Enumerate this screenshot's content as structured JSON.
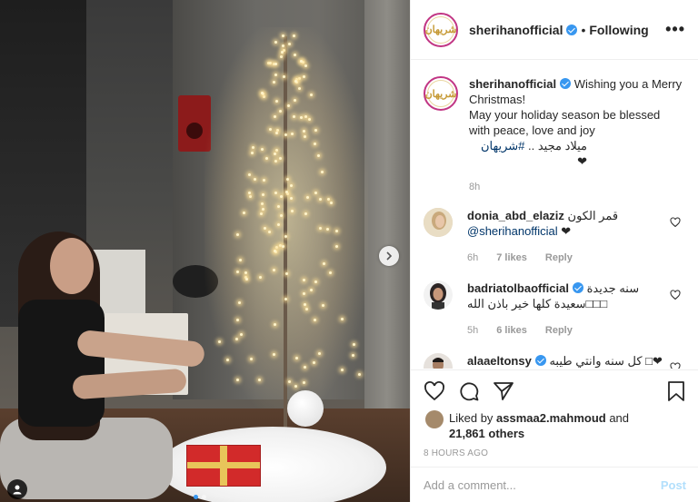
{
  "post": {
    "author": "sherihanofficial",
    "follow_state": "Following",
    "separator": "•",
    "more_label": "•••",
    "avatar_text": "شريهان"
  },
  "caption": {
    "username": "sherihanofficial",
    "line1": "Wishing you a Merry Christmas!",
    "line2": "May your holiday season be blessed with peace, love and joy",
    "line3_text": "ميلاد مجيد .. ",
    "hashtag": "#شريهان",
    "heart": "❤",
    "time": "8h"
  },
  "comments": [
    {
      "username": "donia_abd_elaziz",
      "text": "قمر الكون",
      "mention": "@sherihanofficial",
      "suffix": " ❤",
      "time": "6h",
      "likes": "7 likes",
      "reply": "Reply",
      "verified": false,
      "avatar_color": "#d8c7a8"
    },
    {
      "username": "badriatolbaofficial",
      "text": "سنه جديدة",
      "text2": "سعيدة كلها خير باذن الله□□□",
      "time": "5h",
      "likes": "6 likes",
      "reply": "Reply",
      "verified": true,
      "avatar_color": "#3b3434"
    },
    {
      "username": "alaaeltonsy",
      "text": "كل سنه وانتي طيبه □❤",
      "verified": true,
      "avatar_color": "#5a4a40"
    }
  ],
  "actions": {
    "liked_by_prefix": "Liked by ",
    "liked_by_user": "assmaa2.mahmoud",
    "and": " and",
    "others": "21,861 others",
    "timestamp": "8 hours ago"
  },
  "add_comment": {
    "placeholder": "Add a comment...",
    "post_label": "Post"
  },
  "colors": {
    "verified": "#3897f0",
    "link": "#003569",
    "post_disabled": "#b2dffc",
    "avatar_ring": "#c13584"
  }
}
